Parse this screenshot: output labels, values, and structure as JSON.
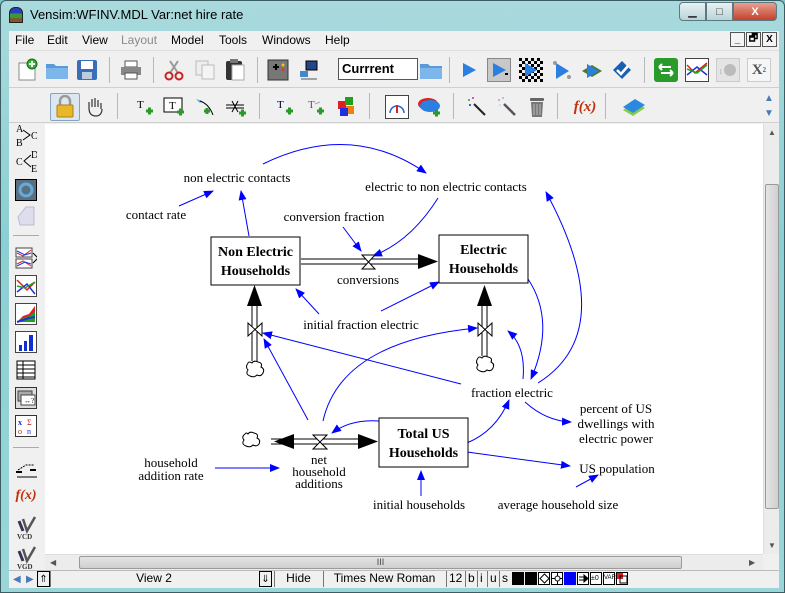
{
  "window": {
    "title": "Vensim:WFINV.MDL Var:net hire rate",
    "minimize_glyph": "▁",
    "maximize_glyph": "□",
    "close_glyph": "X"
  },
  "menubar": {
    "items": [
      {
        "label": "File",
        "enabled": true
      },
      {
        "label": "Edit",
        "enabled": true
      },
      {
        "label": "View",
        "enabled": true
      },
      {
        "label": "Layout",
        "enabled": false
      },
      {
        "label": "Model",
        "enabled": true
      },
      {
        "label": "Tools",
        "enabled": true
      },
      {
        "label": "Windows",
        "enabled": true
      },
      {
        "label": "Help",
        "enabled": true
      }
    ],
    "mdi_controls": {
      "minimize": "_",
      "restore": "🗗",
      "close": "X"
    }
  },
  "toolbar_main": {
    "run_name": "Currrent",
    "icons": [
      "new-model",
      "open-model",
      "save",
      "print",
      "cut",
      "copy",
      "paste",
      "build-windows",
      "publish",
      "browse-run-folder",
      "simulate",
      "synthesim",
      "gaming",
      "sensitivity",
      "optimize",
      "check-model",
      "causal-tracing-back",
      "causes-strip",
      "reality-check",
      "subscripts"
    ]
  },
  "toolbar_sketch": {
    "icons": [
      "lock",
      "move",
      "variable",
      "box-variable",
      "arrow",
      "rate",
      "shadow-variable",
      "input-output",
      "model-merge",
      "sketch-comment",
      "unhide-wand",
      "hide-wand",
      "delete",
      "equations",
      "document"
    ],
    "equations_label": "f(x)"
  },
  "left_toolbar": {
    "icons": [
      "causes-tree",
      "uses-tree",
      "loops",
      "document-view",
      "causes-strip-graph",
      "graph",
      "sensitivity-graph",
      "bar-graph",
      "table",
      "runs-compare",
      "document-equations",
      "reality-check",
      "equations",
      "vcd",
      "vgd"
    ],
    "causes_label": [
      "A",
      "B",
      "C"
    ],
    "uses_label": [
      "C",
      "D",
      "E"
    ],
    "equations_label": "f(x)",
    "vcd_label": "VCD",
    "vgd_label": "VGD"
  },
  "diagram": {
    "stocks": [
      {
        "id": "non-electric-households",
        "lines": [
          "Non Electric",
          "Households"
        ]
      },
      {
        "id": "electric-households",
        "lines": [
          "Electric",
          "Households"
        ]
      },
      {
        "id": "total-us-households",
        "lines": [
          "Total US",
          "Households"
        ]
      }
    ],
    "flows": [
      {
        "id": "conversions",
        "lines": [
          "conversions"
        ]
      },
      {
        "id": "net-household-additions",
        "lines": [
          "net",
          "household",
          "additions"
        ]
      }
    ],
    "variables": [
      {
        "id": "non-electric-contacts",
        "lines": [
          "non electric contacts"
        ]
      },
      {
        "id": "electric-to-non-electric-contacts",
        "lines": [
          "electric to non electric contacts"
        ]
      },
      {
        "id": "contact-rate",
        "lines": [
          "contact rate"
        ]
      },
      {
        "id": "conversion-fraction",
        "lines": [
          "conversion fraction"
        ]
      },
      {
        "id": "initial-fraction-electric",
        "lines": [
          "initial fraction electric"
        ]
      },
      {
        "id": "fraction-electric",
        "lines": [
          "fraction electric"
        ]
      },
      {
        "id": "percent-dwellings",
        "lines": [
          "percent of US",
          "dwellings with",
          "electric power"
        ]
      },
      {
        "id": "household-addition-rate",
        "lines": [
          "household",
          "addition rate"
        ]
      },
      {
        "id": "initial-households",
        "lines": [
          "initial households"
        ]
      },
      {
        "id": "average-household-size",
        "lines": [
          "average household size"
        ]
      },
      {
        "id": "us-population",
        "lines": [
          "US population"
        ]
      }
    ],
    "colors": {
      "link": "#0000ff",
      "flow": "#000000",
      "stock_border": "#000000"
    }
  },
  "statusbar": {
    "view_name": "View 2",
    "hide_label": "Hide",
    "font_name": "Times New Roman",
    "font_size": "12",
    "bold": "b",
    "italic": "i",
    "underline": "u",
    "strikethrough": "s",
    "text_color": "#000000",
    "border_color": "#000000",
    "fill_color": "#0000ff"
  },
  "hscroll_grip": "III"
}
